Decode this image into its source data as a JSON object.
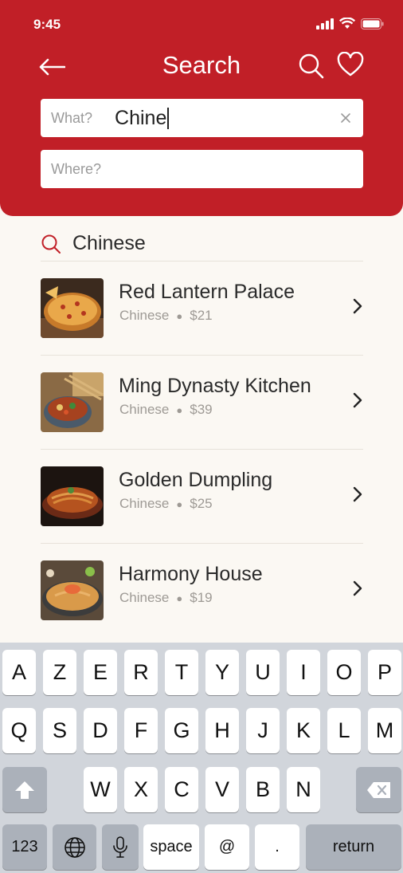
{
  "status": {
    "time": "9:45"
  },
  "header": {
    "title": "Search"
  },
  "search": {
    "what_label": "What?",
    "what_value": "Chine",
    "where_placeholder": "Where?"
  },
  "suggestion": {
    "text": "Chinese"
  },
  "results": [
    {
      "name": "Red Lantern Palace",
      "cuisine": "Chinese",
      "price": "$21"
    },
    {
      "name": "Ming Dynasty Kitchen",
      "cuisine": "Chinese",
      "price": "$39"
    },
    {
      "name": "Golden Dumpling",
      "cuisine": "Chinese",
      "price": "$25"
    },
    {
      "name": "Harmony House",
      "cuisine": "Chinese",
      "price": "$19"
    }
  ],
  "keyboard": {
    "row1": [
      "A",
      "Z",
      "E",
      "R",
      "T",
      "Y",
      "U",
      "I",
      "O",
      "P"
    ],
    "row2": [
      "Q",
      "S",
      "D",
      "F",
      "G",
      "H",
      "J",
      "K",
      "L",
      "M"
    ],
    "row3": [
      "W",
      "X",
      "C",
      "V",
      "B",
      "N"
    ],
    "numbers": "123",
    "space": "space",
    "at": "@",
    "period": ".",
    "return": "return"
  },
  "colors": {
    "brand": "#c11f27",
    "background": "#fbf8f3"
  }
}
